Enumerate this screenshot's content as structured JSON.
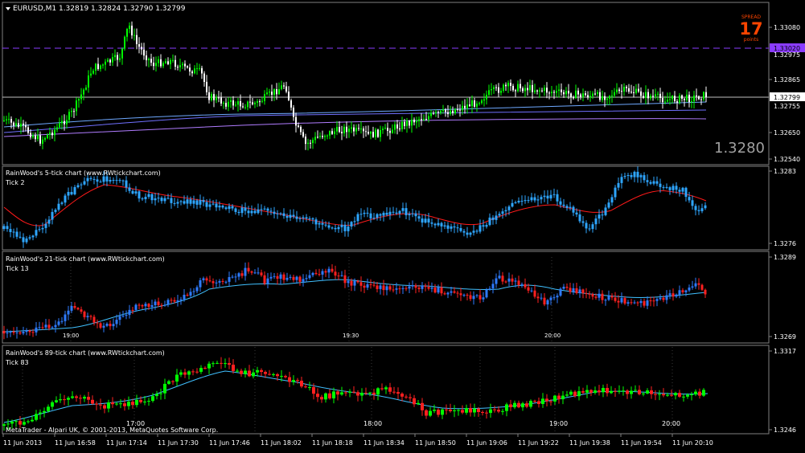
{
  "main": {
    "header": "EURUSD,M1  1.32819 1.32824 1.32790 1.32799",
    "spread_title": "SPREAD",
    "spread_value": "17",
    "spread_unit": "points",
    "big_price": "1.3280",
    "price_labels": [
      "1.33080",
      "1.32975",
      "1.32865",
      "1.32755",
      "1.32650",
      "1.32540"
    ],
    "marker_label": "1.33020",
    "current_label": "1.32799",
    "colors": {
      "bull": "#00ff00",
      "bear": "#ffffff",
      "ma1": "#6ea8ff",
      "ma2": "#7070ff",
      "ma3": "#b07cff",
      "marker": "#8a3cff",
      "current": "#c0c0c0"
    }
  },
  "panel_5": {
    "title": "RainWood's 5-tick chart  (www.RWtickchart.com)",
    "sub": "Tick 2",
    "price_labels": [
      "1.3283",
      "1.3276"
    ],
    "colors": {
      "candle": "#2ea6ff",
      "ma": "#ff1a1a"
    }
  },
  "panel_21": {
    "title": "RainWood's 21-tick chart  (www.RWtickchart.com)",
    "sub": "Tick 13",
    "price_labels": [
      "1.3289",
      "1.3269"
    ],
    "time_labels": [
      "19:00",
      "19:30",
      "20:00"
    ],
    "colors": {
      "up": "#2e7bff",
      "down": "#ff2020",
      "ma": "#40c0ff"
    }
  },
  "panel_89": {
    "title": "RainWood's 89-tick chart  (www.RWtickchart.com)",
    "sub": "Tick 83",
    "price_labels": [
      "1.3317",
      "1.3246"
    ],
    "time_labels": [
      "17:00",
      "18:00",
      "19:00",
      "20:00"
    ],
    "colors": {
      "up": "#00ff00",
      "down": "#ff2020",
      "ma": "#40c0ff"
    }
  },
  "footer": "MetaTrader - Alpari UK, © 2001-2013, MetaQuotes Software Corp.",
  "time_axis": [
    "11 Jun 2013",
    "11 Jun 16:58",
    "11 Jun 17:14",
    "11 Jun 17:30",
    "11 Jun 17:46",
    "11 Jun 18:02",
    "11 Jun 18:18",
    "11 Jun 18:34",
    "11 Jun 18:50",
    "11 Jun 19:06",
    "11 Jun 19:22",
    "11 Jun 19:38",
    "11 Jun 19:54",
    "11 Jun 20:10"
  ]
}
